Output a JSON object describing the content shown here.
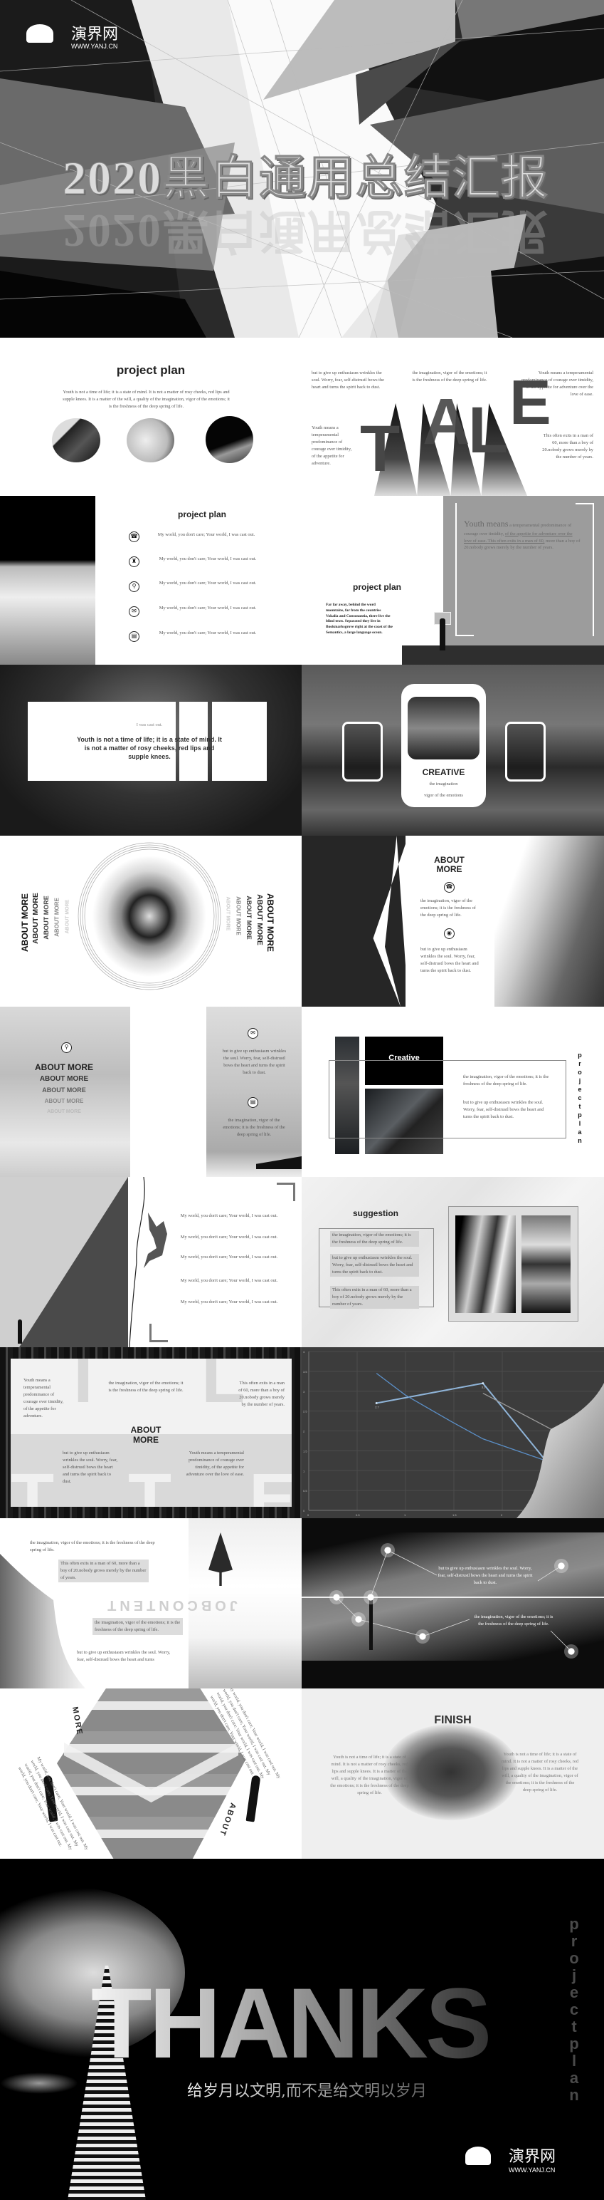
{
  "title_slide": {
    "title": "2020黑白通用总结汇报",
    "logo_text": "演界网",
    "logo_url": "WWW.YANJ.CN"
  },
  "s1": {
    "title": "project plan",
    "paragraph": "Youth is not a time of life; it is a state of mind. It is not a matter of rosy cheeks, red lips and supple knees. It is a matter of the will, a quality of the imagination, vigor of the emotions; it is the freshness of the deep spring of life."
  },
  "s2": {
    "col1": "but to give up enthusiasm wrinkles the soul. Worry, fear, self-distrustl bows the heart and turns the spirit back to dust.",
    "col2": "the imagination, vigor of the emotions; it is the freshness of the deep spring of life.",
    "col3": "Youth means a temperamental predominance of courage over timidity, of the appetite for adventure over the love of ease.",
    "left": "Youth means a temperamental predominance of courage over timidity, of the appetite for adventure.",
    "right": "This often exits in a man of 60, more than a boy of 20.nobody grows merely by the number of years.",
    "letters": [
      "T",
      "A",
      "L",
      "E"
    ]
  },
  "s3": {
    "title": "project plan",
    "items": [
      {
        "icon": "phone-icon",
        "glyph": "☎",
        "text": "My world, you don't care; Your world, I was cast out."
      },
      {
        "icon": "bag-icon",
        "glyph": "♜",
        "text": "My world, you don't care; Your world, I was cast out."
      },
      {
        "icon": "location-pin-icon",
        "glyph": "⚲",
        "text": "My world, you don't care; Your world, I was cast out."
      },
      {
        "icon": "mail-icon",
        "glyph": "✉",
        "text": "My world, you don't care; Your world, I was cast out."
      },
      {
        "icon": "document-icon",
        "glyph": "▤",
        "text": "My world, you don't care; Your world, I was cast out."
      }
    ]
  },
  "s4": {
    "title": "project plan",
    "paragraph": "Far far away, behind the word mountains, far from the countries Vokalia and Consonantia, there live the blind texts. Separated they live in Bookmarksgrove right at the coast of the Semantics, a large language ocean.",
    "quote_lead": "Youth means",
    "quote_rest": " a temperamental predominance of courage over timidity, ",
    "quote_underlined": "of the appetite for adventure over the love of ease. This often exits in a man of 60,",
    "quote_tail": " more than a boy of 20.nobody grows merely by the number of years."
  },
  "s5": {
    "small": "I was cast out.",
    "main": "Youth is not a time of life; it is a state of mind. It is not a matter of rosy cheeks, red lips and supple knees."
  },
  "s6": {
    "title": "CREATIVE",
    "line1": "the imagination",
    "line2": "vigor of the emotions"
  },
  "s7": {
    "left_repeat": [
      "ABOUT MORE",
      "ABOUT MORE",
      "ABOUT MORE",
      "ABOUT MORE",
      "ABOUT MORE"
    ],
    "right_repeat": [
      "ABOUT MORE",
      "ABOUT MORE",
      "ABOUT MORE",
      "ABOUT MORE",
      "ABOUT MORE"
    ]
  },
  "s8": {
    "title": "ABOUT MORE",
    "text1": "the imagination, vigor of the emotions; it is the freshness of the deep spring of life.",
    "text2": "but to give up enthusiasm wrinkles the soul. Worry, fear, self-distrustl bows the heart and turns the spirit back to dust."
  },
  "s9": {
    "repeat": [
      "ABOUT MORE",
      "ABOUT MORE",
      "ABOUT MORE",
      "ABOUT MORE",
      "ABOUT MORE"
    ],
    "text1": "but to give up enthusiasm wrinkles the soul. Worry, fear, self-distrustl bows the heart and turns the spirit back to dust.",
    "text2": "the imagination, vigor of the emotions; it is the freshness of the deep spring of life."
  },
  "s10": {
    "title": "Creative",
    "text1": "the imagination, vigor of the emotions; it is the freshness of the deep spring of life.",
    "text2": "but to give up enthusiasm wrinkles the soul. Worry, fear, self-distrustl bows the heart and turns the spirit back to dust.",
    "vertical": [
      "p",
      "r",
      "o",
      "j",
      "e",
      "c",
      "t",
      "p",
      "l",
      "a",
      "n"
    ]
  },
  "s11": {
    "items": [
      "My world, you don't care; Your world, I was cast out.",
      "My world, you don't care; Your world, I was cast out.",
      "My world, you don't care; Your world, I was cast out.",
      "My world, you don't care; Your world, I was cast out.",
      "My world, you don't care; Your world, I was cast out."
    ]
  },
  "s12": {
    "title": "suggestion",
    "boxes": [
      "the imagination, vigor of the emotions; it is the freshness of the deep spring of life.",
      "but to give up enthusiasm wrinkles the soul. Worry, fear, self-distrustl bows the heart and turns the spirit back to dust.",
      "This often exits in a man of 60, more than a boy of 20.nobody grows merely by the number of years."
    ]
  },
  "s13": {
    "letters": [
      "T",
      "I",
      "T",
      "L",
      "E"
    ],
    "title": "ABOUT MORE",
    "t1": "Youth means a temperamental predominance of courage over timidity, of the appetite for adventure.",
    "t2": "the imagination, vigor of the emotions; it is the freshness of the deep spring of life.",
    "t3": "This often exits in a man of 60, more than a boy of 20.nobody grows merely by the number of years.",
    "t4": "but to give up enthusiasm wrinkles the soul. Worry, fear, self-distrustl bows the heart and turns the spirit back to dust.",
    "t5": "Youth means a temperamental predominance of courage over timidity, of the appetite for adventure over the love of ease."
  },
  "chart_data": {
    "type": "line",
    "xlim": [
      0,
      2.5
    ],
    "ylim": [
      0,
      4
    ],
    "x_ticks": [
      "0",
      "0.5",
      "1",
      "1.5",
      "2"
    ],
    "y_ticks": [
      "0",
      "0.5",
      "1",
      "1.5",
      "2",
      "2.5",
      "3",
      "3.5",
      "4"
    ],
    "grid": true,
    "background": "#3c3c3c",
    "series": [
      {
        "x": [
          0.7,
          1.8,
          2.45
        ],
        "y": [
          2.7,
          3.2,
          1.25
        ],
        "color": "#8fb4d8",
        "labels": [
          "2.7",
          "3.2",
          ""
        ]
      },
      {
        "x": [
          0.7,
          1.0,
          1.5,
          1.8,
          2.45
        ],
        "y": [
          3.45,
          2.9,
          2.2,
          1.8,
          1.25
        ],
        "color": "#5b8fc7",
        "labels": []
      },
      {
        "x": [
          1.8,
          2.5
        ],
        "y": [
          2.95,
          2.05
        ],
        "color": "#9a9a9a",
        "labels": []
      }
    ]
  },
  "s15": {
    "t1": "the imagination, vigor of the emotions; it is the freshness of the deep spring of life.",
    "t2": "This often exits in a man of 60, more than a boy of 20.nobody grows merely by the number of years.",
    "mirror": "JOBCONTENT",
    "t3": "the imagination, vigor of the emotions; it is the freshness of the deep spring of life.",
    "t4": "but to give up enthusiasm wrinkles the soul. Worry, fear, self-distrustl bows the heart and turns"
  },
  "s16": {
    "t1": "but to give up enthusiasm wrinkles the soul. Worry, fear, self-distrustl bows the heart and turns the spirit back to dust.",
    "t2": "the imagination, vigor of the emotions; it is the freshness of the deep spring of life."
  },
  "s17": {
    "word1": "MORE",
    "word2": "ABOUT",
    "diag": "My world, you don't care; Your world, I was cast out. My world, you don't care; Your world, I was cast out. My world, you don't care; Your world, I was cast out. My world, you don't care; Your world, I was cast out."
  },
  "s18": {
    "title": "FINISH",
    "left": "Youth is not a time of life; it is a state of mind. It is not a matter of rosy cheeks, red lips and supple knees. It is a matter of the will, a quality of the imagination, vigor of the emotions; it is the freshness of the deep spring of life.",
    "right": "Youth is not a time of life; it is a state of mind. It is not a matter of rosy cheeks, red lips and supple knees. It is a matter of the will, a quality of the imagination, vigor of the emotions; it is the freshness of the deep spring of life."
  },
  "thanks": {
    "title": "THANKS",
    "slogan": "给岁月以文明,而不是给文明以岁月",
    "vertical": [
      "p",
      "r",
      "o",
      "j",
      "e",
      "c",
      "t",
      "p",
      "l",
      "a",
      "n"
    ],
    "logo_text": "演界网",
    "logo_url": "WWW.YANJ.CN"
  }
}
